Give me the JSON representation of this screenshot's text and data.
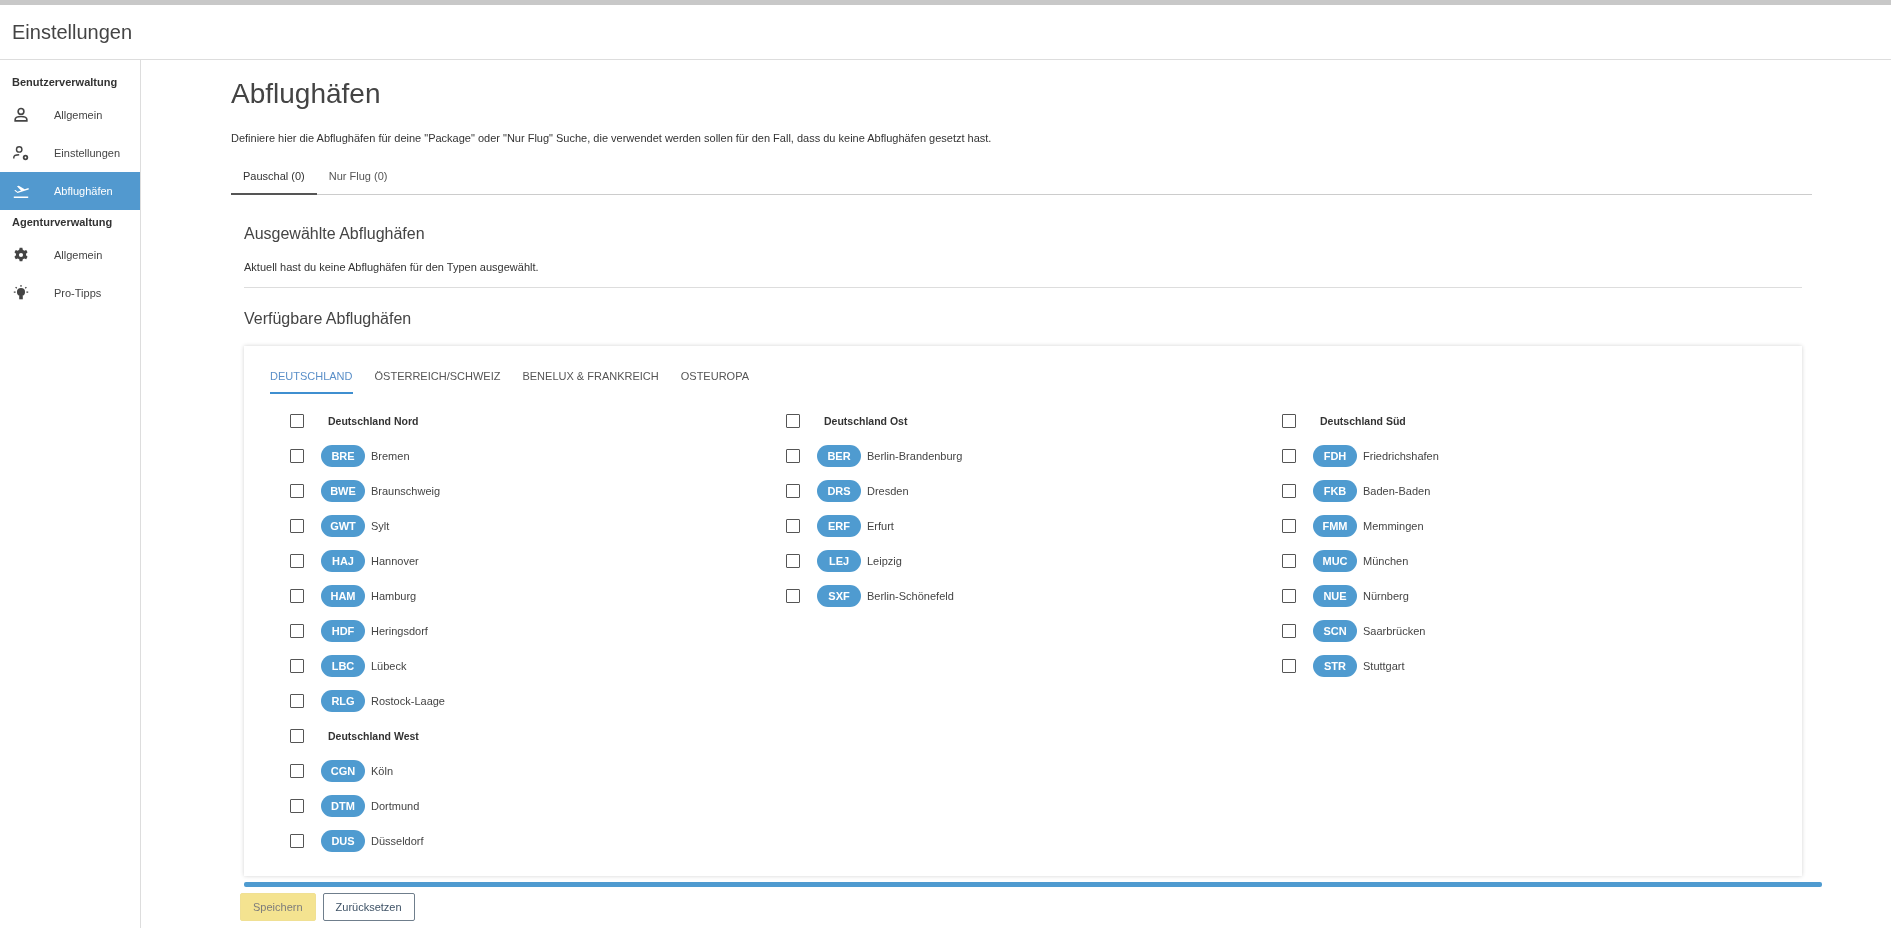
{
  "header": {
    "title": "Einstellungen"
  },
  "sidebar": {
    "sections": [
      {
        "title": "Benutzerverwaltung",
        "items": [
          {
            "label": "Allgemein",
            "kind": "user",
            "selected": false
          },
          {
            "label": "Einstellungen",
            "kind": "user-gear",
            "selected": false
          },
          {
            "label": "Abflughäfen",
            "kind": "plane",
            "selected": true
          }
        ]
      },
      {
        "title": "Agenturverwaltung",
        "items": [
          {
            "label": "Allgemein",
            "kind": "gear",
            "selected": false
          },
          {
            "label": "Pro-Tipps",
            "kind": "bulb",
            "selected": false
          }
        ]
      }
    ]
  },
  "page": {
    "title": "Abflughäfen",
    "description": "Definiere hier die Abflughäfen für deine \"Package\" oder \"Nur Flug\" Suche, die verwendet werden sollen für den Fall, dass du keine Abflughäfen gesetzt hast.",
    "tabs": [
      {
        "label": "Pauschal (0)",
        "selected": true
      },
      {
        "label": "Nur Flug (0)",
        "selected": false
      }
    ],
    "selected_section": {
      "title": "Ausgewählte Abflughäfen",
      "text": "Aktuell hast du keine Abflughäfen für den Typen ausgewählt."
    },
    "available_section": {
      "title": "Verfügbare Abflughäfen",
      "region_tabs": [
        {
          "label": "DEUTSCHLAND",
          "selected": true
        },
        {
          "label": "ÖSTERREICH/SCHWEIZ",
          "selected": false
        },
        {
          "label": "BENELUX & FRANKREICH",
          "selected": false
        },
        {
          "label": "OSTEUROPA",
          "selected": false
        }
      ],
      "columns": [
        [
          {
            "name": "Deutschland Nord",
            "checked": false,
            "airports": [
              {
                "code": "BRE",
                "name": "Bremen",
                "checked": false
              },
              {
                "code": "BWE",
                "name": "Braunschweig",
                "checked": false
              },
              {
                "code": "GWT",
                "name": "Sylt",
                "checked": false
              },
              {
                "code": "HAJ",
                "name": "Hannover",
                "checked": false
              },
              {
                "code": "HAM",
                "name": "Hamburg",
                "checked": false
              },
              {
                "code": "HDF",
                "name": "Heringsdorf",
                "checked": false
              },
              {
                "code": "LBC",
                "name": "Lübeck",
                "checked": false
              },
              {
                "code": "RLG",
                "name": "Rostock-Laage",
                "checked": false
              }
            ]
          },
          {
            "name": "Deutschland West",
            "checked": false,
            "airports": [
              {
                "code": "CGN",
                "name": "Köln",
                "checked": false
              },
              {
                "code": "DTM",
                "name": "Dortmund",
                "checked": false
              },
              {
                "code": "DUS",
                "name": "Düsseldorf",
                "checked": false
              }
            ]
          }
        ],
        [
          {
            "name": "Deutschland Ost",
            "checked": false,
            "airports": [
              {
                "code": "BER",
                "name": "Berlin-Brandenburg",
                "checked": false
              },
              {
                "code": "DRS",
                "name": "Dresden",
                "checked": false
              },
              {
                "code": "ERF",
                "name": "Erfurt",
                "checked": false
              },
              {
                "code": "LEJ",
                "name": "Leipzig",
                "checked": false
              },
              {
                "code": "SXF",
                "name": "Berlin-Schönefeld",
                "checked": false
              }
            ]
          }
        ],
        [
          {
            "name": "Deutschland Süd",
            "checked": false,
            "airports": [
              {
                "code": "FDH",
                "name": "Friedrichshafen",
                "checked": false
              },
              {
                "code": "FKB",
                "name": "Baden-Baden",
                "checked": false
              },
              {
                "code": "FMM",
                "name": "Memmingen",
                "checked": false
              },
              {
                "code": "MUC",
                "name": "München",
                "checked": false
              },
              {
                "code": "NUE",
                "name": "Nürnberg",
                "checked": false
              },
              {
                "code": "SCN",
                "name": "Saarbrücken",
                "checked": false
              },
              {
                "code": "STR",
                "name": "Stuttgart",
                "checked": false
              }
            ]
          }
        ]
      ]
    },
    "buttons": [
      {
        "label": "Speichern",
        "kind": "primary",
        "disabled": true
      },
      {
        "label": "Zurücksetzen",
        "kind": "secondary",
        "disabled": false
      }
    ]
  }
}
